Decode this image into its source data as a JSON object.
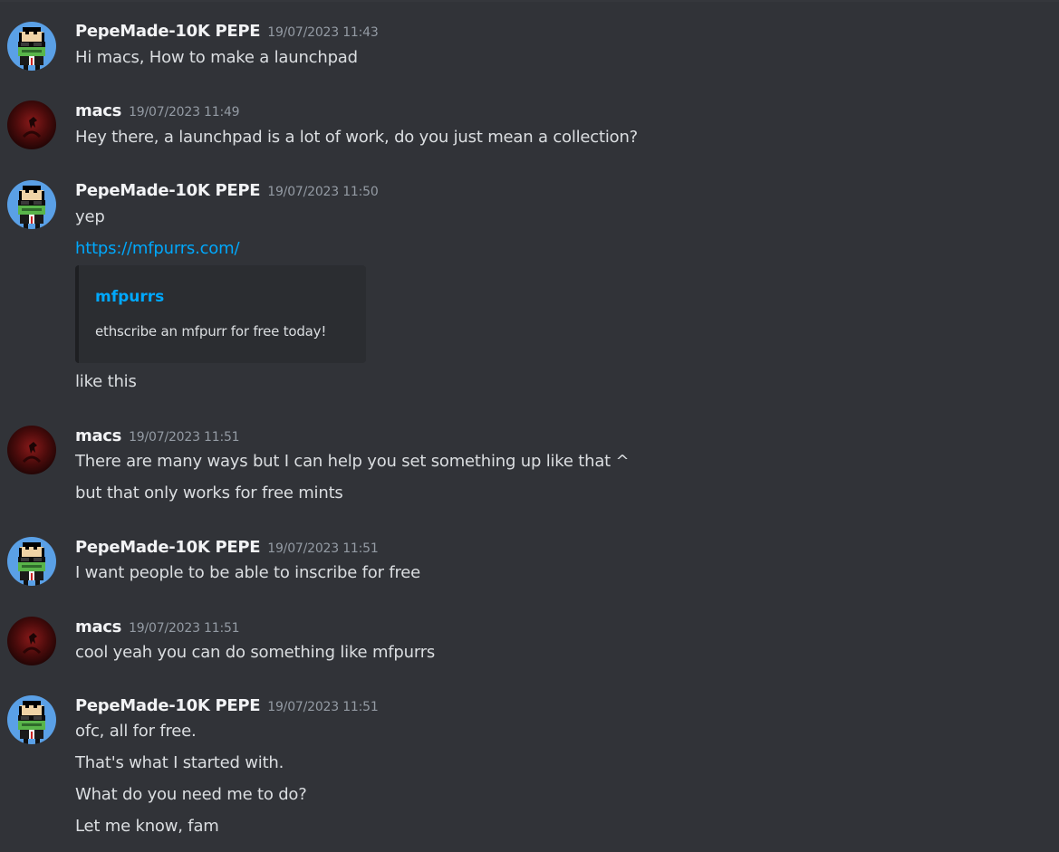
{
  "messages": [
    {
      "user": "PepeMade-10K PEPE",
      "avatar": "pepe-avatar",
      "time": "19/07/2023 11:43",
      "lines": [
        "Hi macs, How to make a launchpad"
      ]
    },
    {
      "user": "macs",
      "avatar": "macs-avatar",
      "time": "19/07/2023 11:49",
      "lines": [
        "Hey there, a launchpad is a lot of work, do you just mean a collection?"
      ]
    },
    {
      "user": "PepeMade-10K PEPE",
      "avatar": "pepe-avatar",
      "time": "19/07/2023 11:50",
      "lines": [
        "yep"
      ],
      "link": "https://mfpurrs.com/",
      "embed": {
        "title": "mfpurrs",
        "description": "ethscribe an mfpurr for free today!"
      },
      "after_embed": "like this"
    },
    {
      "user": "macs",
      "avatar": "macs-avatar",
      "time": "19/07/2023 11:51",
      "lines": [
        "There are many ways but I can help you set something up like that ^",
        "but that only works for free mints"
      ]
    },
    {
      "user": "PepeMade-10K PEPE",
      "avatar": "pepe-avatar",
      "time": "19/07/2023 11:51",
      "lines": [
        "I want people to be able to inscribe for free"
      ]
    },
    {
      "user": "macs",
      "avatar": "macs-avatar",
      "time": "19/07/2023 11:51",
      "lines": [
        "cool yeah you can do something like mfpurrs"
      ]
    },
    {
      "user": "PepeMade-10K PEPE",
      "avatar": "pepe-avatar",
      "time": "19/07/2023 11:51",
      "lines": [
        "ofc, all for free.",
        "That's what I started with.",
        "What do you need me to do?",
        "Let me know, fam"
      ]
    }
  ],
  "colors": {
    "background": "#313338",
    "username": "#f2f3f5",
    "timestamp": "#949ba4",
    "text": "#dbdee1",
    "link": "#00a8fc",
    "embed_bg": "#2b2d31"
  }
}
